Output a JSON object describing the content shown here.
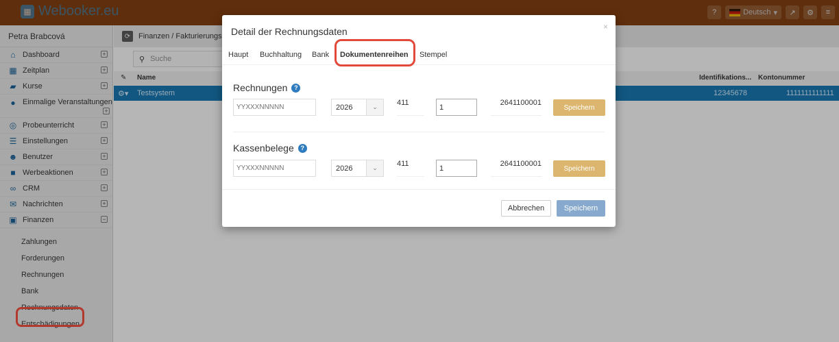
{
  "app": {
    "brand": "Webooker.eu"
  },
  "topbar": {
    "help_icon": "question-icon",
    "language": "Deutsch",
    "external_icon": "external-link-icon",
    "settings_icon": "gear-icon",
    "menu_icon": "hamburger-icon"
  },
  "sidebar": {
    "user": "Petra Brabcová",
    "items": [
      {
        "label": "Dashboard",
        "icon": "home-icon"
      },
      {
        "label": "Zeitplan",
        "icon": "calendar-icon"
      },
      {
        "label": "Kurse",
        "icon": "book-icon"
      },
      {
        "label": "Einmalige Veranstaltungen",
        "icon": "soccer-ball-icon"
      },
      {
        "label": "Probeunterricht",
        "icon": "eye-icon"
      },
      {
        "label": "Einstellungen",
        "icon": "settings-list-icon"
      },
      {
        "label": "Benutzer",
        "icon": "users-icon"
      },
      {
        "label": "Werbeaktionen",
        "icon": "gift-icon"
      },
      {
        "label": "CRM",
        "icon": "handshake-icon"
      },
      {
        "label": "Nachrichten",
        "icon": "envelope-icon"
      },
      {
        "label": "Finanzen",
        "icon": "money-icon"
      }
    ],
    "finance_sub": [
      "Zahlungen",
      "Forderungen",
      "Rechnungen",
      "Bank",
      "Rechnungsdaten",
      "Entschädigungen"
    ]
  },
  "main": {
    "breadcrumb": "Finanzen / Fakturierungsd",
    "search_placeholder": "Suche",
    "columns": {
      "name": "Name",
      "ident": "Identifikations...",
      "konto": "Kontonummer"
    },
    "row": {
      "name": "Testsystem",
      "ident": "12345678",
      "konto": "1111111111111"
    }
  },
  "modal": {
    "title": "Detail der Rechnungsdaten",
    "close": "×",
    "tabs": [
      "Haupt",
      "Buchhaltung",
      "Bank",
      "Dokumentenreihen",
      "Stempel"
    ],
    "sections": [
      {
        "title": "Rechnungen",
        "pattern_placeholder": "YYXXXNNNNN",
        "year": "2026",
        "prefix": "411",
        "counter": "1",
        "preview": "2641100001",
        "save": "Speichern"
      },
      {
        "title": "Kassenbelege",
        "pattern_placeholder": "YYXXXNNNNN",
        "year": "2026",
        "prefix": "411",
        "counter": "1",
        "preview": "2641100001",
        "save": "Speichern"
      }
    ],
    "cancel": "Abbrechen",
    "save": "Speichern"
  },
  "colors": {
    "topbar": "#7a3c10",
    "selected_row": "#1670a6",
    "section_save": "#dcb66e",
    "primary_save": "#86a9cd",
    "highlight": "#e3493b"
  }
}
